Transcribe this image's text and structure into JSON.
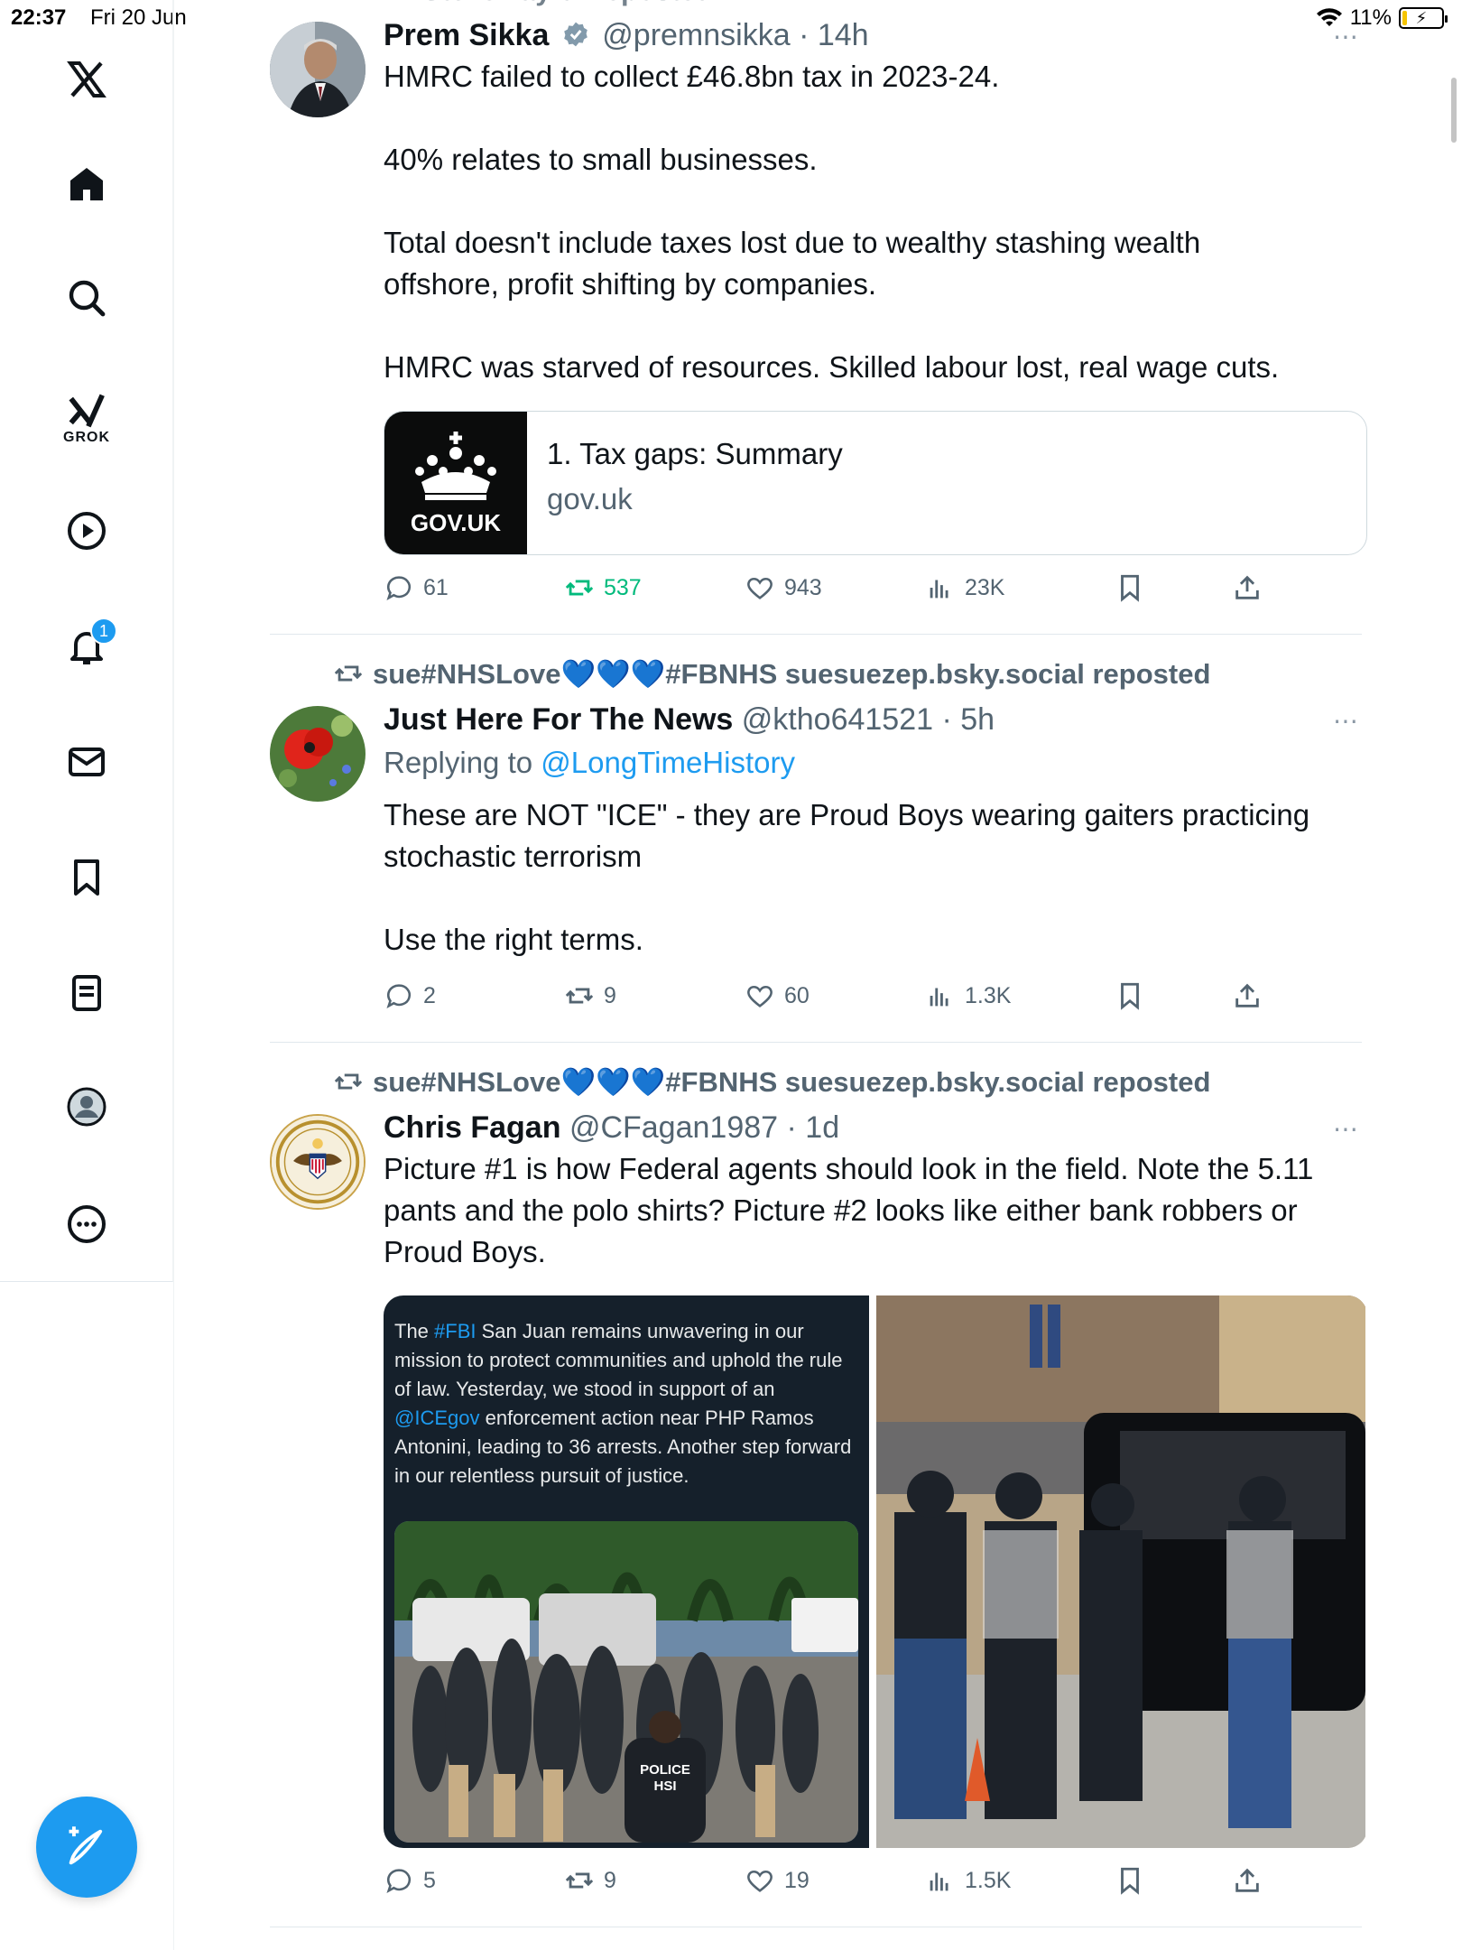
{
  "status": {
    "time": "22:37",
    "date": "Fri 20 Jun",
    "battery": "11%",
    "battery_level": 0.11
  },
  "sidebar": {
    "items": [
      {
        "icon": "x-logo-icon"
      },
      {
        "icon": "home-icon"
      },
      {
        "icon": "search-icon"
      },
      {
        "icon": "grok-icon",
        "label": "GROK"
      },
      {
        "icon": "video-icon"
      },
      {
        "icon": "notifications-icon",
        "badge": "1"
      },
      {
        "icon": "messages-icon"
      },
      {
        "icon": "bookmarks-icon"
      },
      {
        "icon": "lists-icon"
      },
      {
        "icon": "profile-icon"
      },
      {
        "icon": "more-icon"
      }
    ],
    "compose_icon": "compose-icon"
  },
  "tweets": [
    {
      "repost_partial": "Dr Steve Taylor reposted",
      "name": "Prem Sikka",
      "handle": "@premnsikka",
      "time": "14h",
      "verified": true,
      "text": "HMRC failed to collect £46.8bn tax in 2023-24.\n\n40% relates to small businesses.\n\nTotal doesn't include taxes lost due to wealthy stashing wealth\noffshore, profit shifting by companies.\n\nHMRC was starved of resources. Skilled labour lost, real wage cuts.",
      "card": {
        "thumb_label": "GOV.UK",
        "title": "1. Tax gaps: Summary",
        "domain": "gov.uk"
      },
      "stats": {
        "replies": "61",
        "reposts": "537",
        "likes": "943",
        "views": "23K"
      },
      "reposted_by_me": true
    },
    {
      "repost_prefix": "sue#NHSLove",
      "repost_hearts": "💙💙💙",
      "repost_suffix": "#FBNHS suesuezep.bsky.social reposted",
      "name": "Just Here For The News",
      "handle": "@ktho641521",
      "time": "5h",
      "reply_label": "Replying to",
      "reply_to": "@LongTimeHistory",
      "text": "These are NOT \"ICE\" - they are Proud Boys wearing gaiters practicing\nstochastic terrorism\n\nUse the right terms.",
      "stats": {
        "replies": "2",
        "reposts": "9",
        "likes": "60",
        "views": "1.3K"
      }
    },
    {
      "repost_prefix": "sue#NHSLove",
      "repost_hearts": "💙💙💙",
      "repost_suffix": "#FBNHS suesuezep.bsky.social reposted",
      "name": "Chris Fagan",
      "handle": "@CFagan1987",
      "time": "1d",
      "text": "Picture #1 is how Federal agents should look in the field. Note the 5.11\npants and the polo shirts? Picture #2 looks like either bank robbers or\nProud Boys.",
      "media_caption": {
        "pre": "The ",
        "tag1": "#FBI",
        "mid": " San Juan remains unwavering in our mission to protect communities and uphold the rule of law. Yesterday, we stood in support of an ",
        "tag2": "@ICEgov",
        "post": " enforcement action near PHP Ramos Antonini, leading to 36 arrests. Another step forward in our relentless pursuit of justice."
      },
      "photo_vest_label": "POLICE\nHSI",
      "stats": {
        "replies": "5",
        "reposts": "9",
        "likes": "19",
        "views": "1.5K"
      }
    }
  ],
  "colors": {
    "accent": "#1d9bf0",
    "repost_green": "#00ba7c",
    "secondary_text": "#536471",
    "divider": "#e1e8ed"
  }
}
